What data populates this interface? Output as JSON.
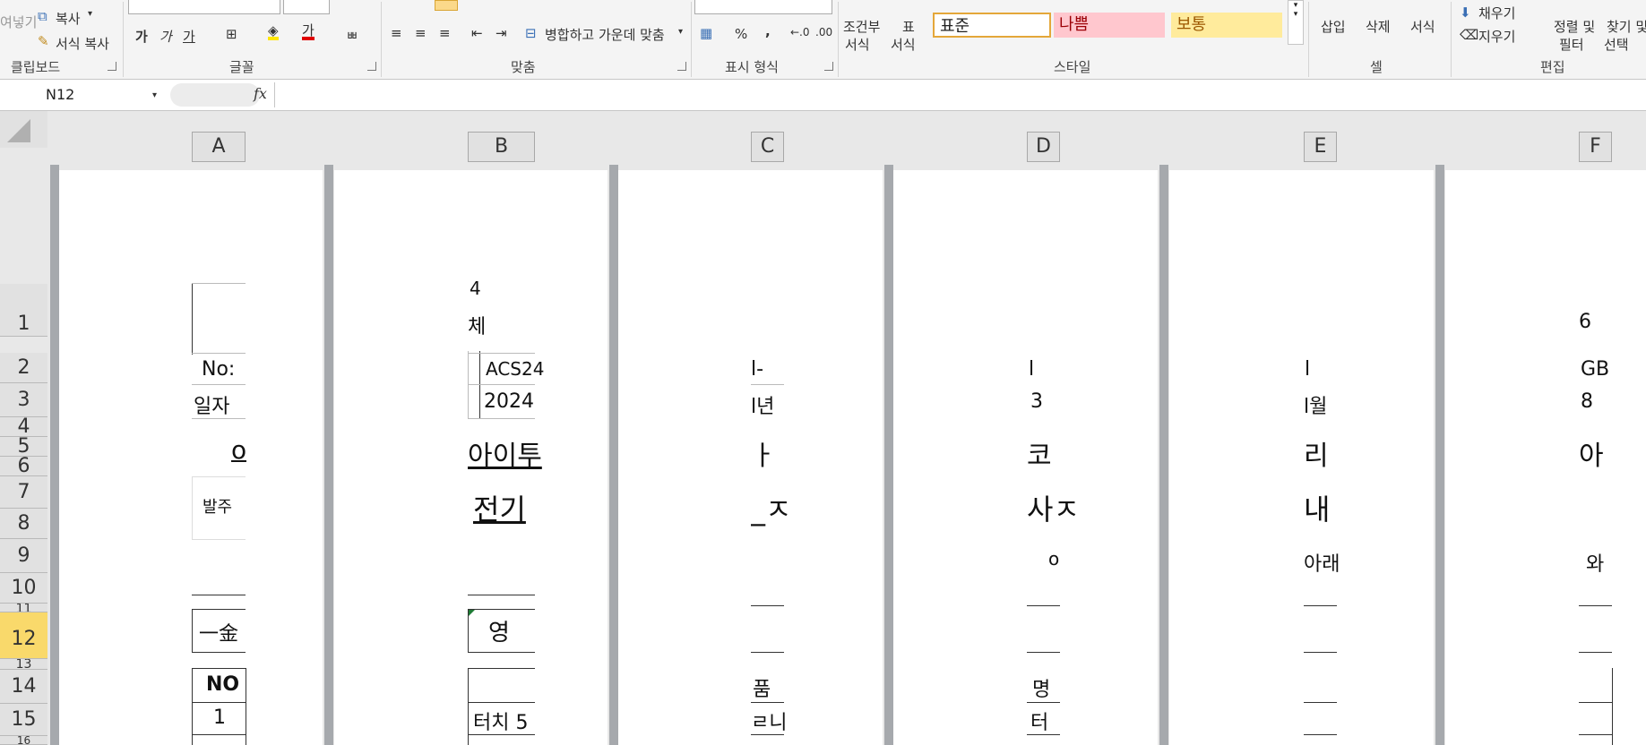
{
  "ribbon": {
    "clipboard": {
      "paste_partial": "여넣기",
      "copy": "복사",
      "format_painter": "서식 복사",
      "label": "클립보드"
    },
    "font": {
      "bold": "가",
      "italic": "가",
      "underline": "가",
      "label": "글꼴"
    },
    "alignment": {
      "merge_center": "병합하고 가운데 맞춤",
      "label": "맞춤"
    },
    "number": {
      "percent": "%",
      "comma": ",",
      "label": "표시 형식"
    },
    "styles": {
      "conditional_line1": "조건부",
      "conditional_line2": "서식",
      "table_line1": "표",
      "table_line2": "서식",
      "normal": "표준",
      "bad": "나쁨",
      "neutral": "보통",
      "label": "스타일"
    },
    "cells": {
      "insert": "삽입",
      "delete": "삭제",
      "format": "서식",
      "label": "셀"
    },
    "editing": {
      "fill": "채우기",
      "clear": "지우기",
      "sort_line1": "정렬 및",
      "sort_line2": "필터",
      "find_line1": "찾기 및",
      "find_line2": "선택",
      "label": "편집"
    }
  },
  "formula_bar": {
    "name_box": "N12",
    "fx": "fx"
  },
  "columns": [
    "A",
    "B",
    "C",
    "D",
    "E",
    "F"
  ],
  "rows": [
    "1",
    "2",
    "3",
    "4",
    "5",
    "6",
    "7",
    "8",
    "9",
    "10",
    "11",
    "12",
    "13",
    "14",
    "15",
    "16"
  ],
  "sheet": {
    "a2": "No:",
    "a3": "일자",
    "a5": "o",
    "a7": "발주",
    "a12": "一金",
    "a14": "NO",
    "a15": "1",
    "b1": "4",
    "b1b": "체",
    "b2": "ACS24",
    "b3": "2024",
    "b5": "아이투",
    "b8": "전기",
    "b12": "영",
    "b15": "터치 5",
    "c2": "l-",
    "c3": "l년",
    "c5": "ㅏ",
    "c8": "_ㅈ",
    "c14": "품",
    "c15": "ㄹ니",
    "d2": "l",
    "d3": "3",
    "d5": "코",
    "d8": "사ㅈ",
    "d10": "o",
    "d14": "명",
    "d15": "터",
    "e2": "l",
    "e3": "l월",
    "e5": "리",
    "e8": "내",
    "e10": "아래",
    "f1": "6",
    "f2": "GB",
    "f3": "8",
    "f5": "아",
    "f10": "와"
  }
}
